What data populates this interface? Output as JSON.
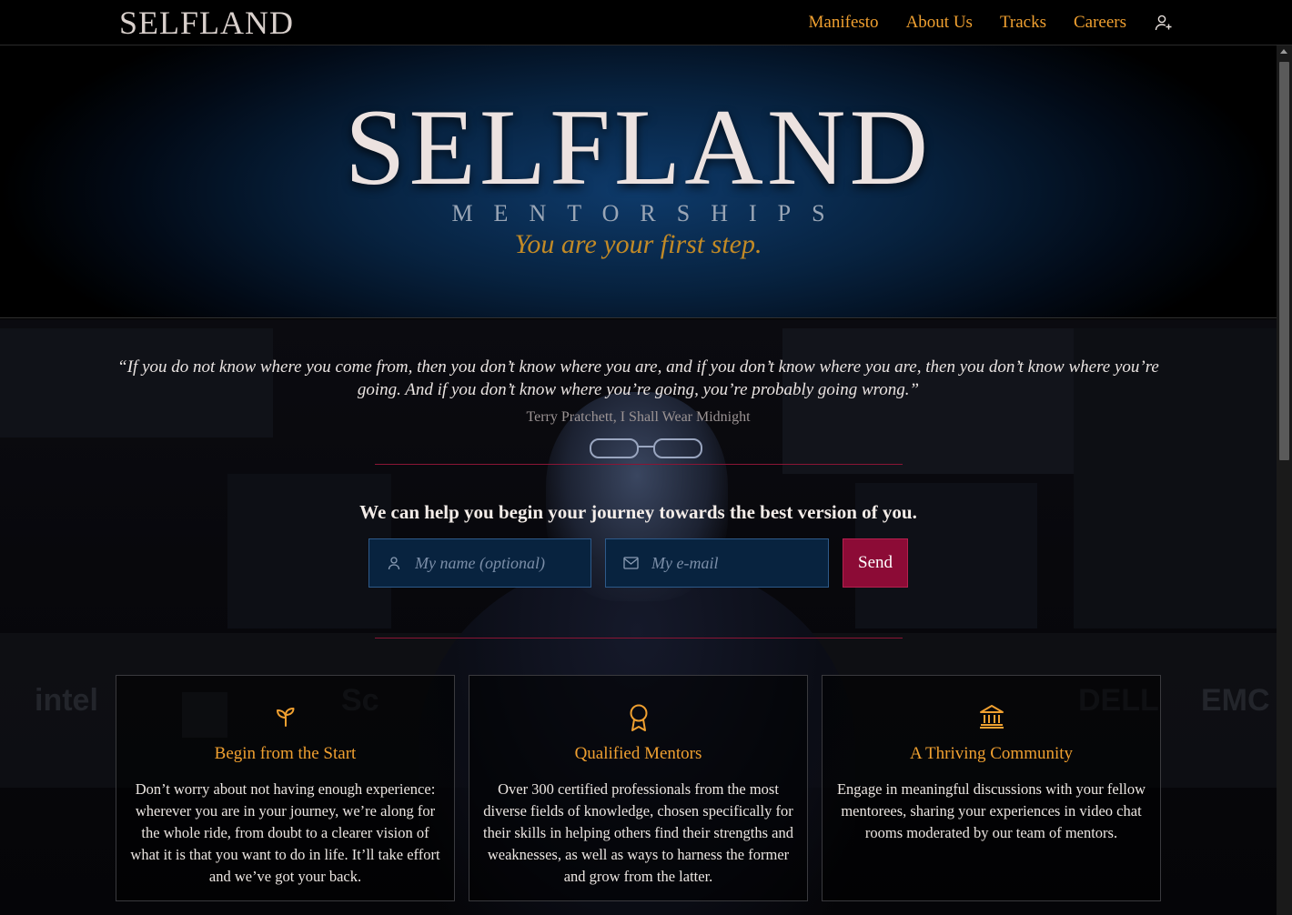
{
  "nav": {
    "logo": "SELFLAND",
    "links": [
      "Manifesto",
      "About Us",
      "Tracks",
      "Careers"
    ],
    "user_icon": "user-plus-icon"
  },
  "hero": {
    "brand": "SELFLAND",
    "subtitle": "MENTORSHIPS",
    "tagline": "You are your first step."
  },
  "quote": {
    "text": "“If you do not know where you come from, then you don’t know where you are, and if you don’t know where you are, then you don’t know where you’re going. And if you don’t know where you’re going, you’re probably going wrong.”",
    "author": "Terry Pratchett, I Shall Wear Midnight"
  },
  "signup": {
    "heading": "We can help you begin your journey towards the best version of you.",
    "name_placeholder": "My name (optional)",
    "email_placeholder": "My e-mail",
    "send_label": "Send",
    "name_icon": "user-icon",
    "email_icon": "mail-icon"
  },
  "cards": [
    {
      "icon": "sprout-icon",
      "title": "Begin from the Start",
      "text": "Don’t worry about not having enough experience: wherever you are in your journey, we’re along for the whole ride, from doubt to a clearer vision of what it is that you want to do in life. It’ll take effort and we’ve got your back."
    },
    {
      "icon": "award-icon",
      "title": "Qualified Mentors",
      "text": "Over 300 certified professionals from the most diverse fields of knowledge, chosen specifically for their skills in helping others find their strengths and weaknesses, as well as ways to harness the former and grow from the latter."
    },
    {
      "icon": "bank-icon",
      "title": "A Thriving Community",
      "text": "Engage in meaningful discussions with your fellow mentorees, sharing your experiences in video chat rooms moderated by our team of mentors."
    }
  ],
  "colors": {
    "accent": "#f0a030",
    "send": "#8c0b36",
    "field": "#08233f",
    "divider": "#8a1535"
  }
}
